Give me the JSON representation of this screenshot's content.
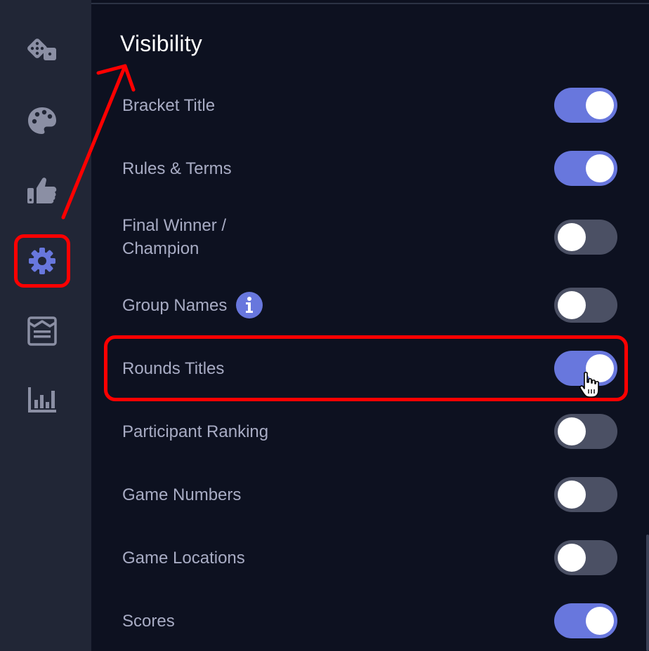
{
  "sidebar": {
    "items": [
      {
        "name": "dice-icon",
        "active": false
      },
      {
        "name": "palette-icon",
        "active": false
      },
      {
        "name": "thumbs-up-icon",
        "active": false
      },
      {
        "name": "gear-icon",
        "active": true
      },
      {
        "name": "newspaper-icon",
        "active": false
      },
      {
        "name": "bar-chart-icon",
        "active": false
      }
    ]
  },
  "visibility": {
    "title": "Visibility",
    "settings": [
      {
        "label": "Bracket Title",
        "enabled": true
      },
      {
        "label": "Rules & Terms",
        "enabled": true
      },
      {
        "label_line1": "Final Winner /",
        "label_line2": "Champion",
        "enabled": false
      },
      {
        "label": "Group Names",
        "enabled": false,
        "info_icon": "info-icon"
      },
      {
        "label": "Rounds Titles",
        "enabled": true
      },
      {
        "label": "Participant Ranking",
        "enabled": false
      },
      {
        "label": "Game Numbers",
        "enabled": false
      },
      {
        "label": "Game Locations",
        "enabled": false
      },
      {
        "label": "Scores",
        "enabled": true
      }
    ]
  },
  "colors": {
    "sidebar_bg": "#212636",
    "main_bg": "#0d1120",
    "toggle_on": "#6877dd",
    "toggle_off": "#4b5064",
    "active_icon": "#6877dd",
    "annotation": "#ff0000"
  }
}
